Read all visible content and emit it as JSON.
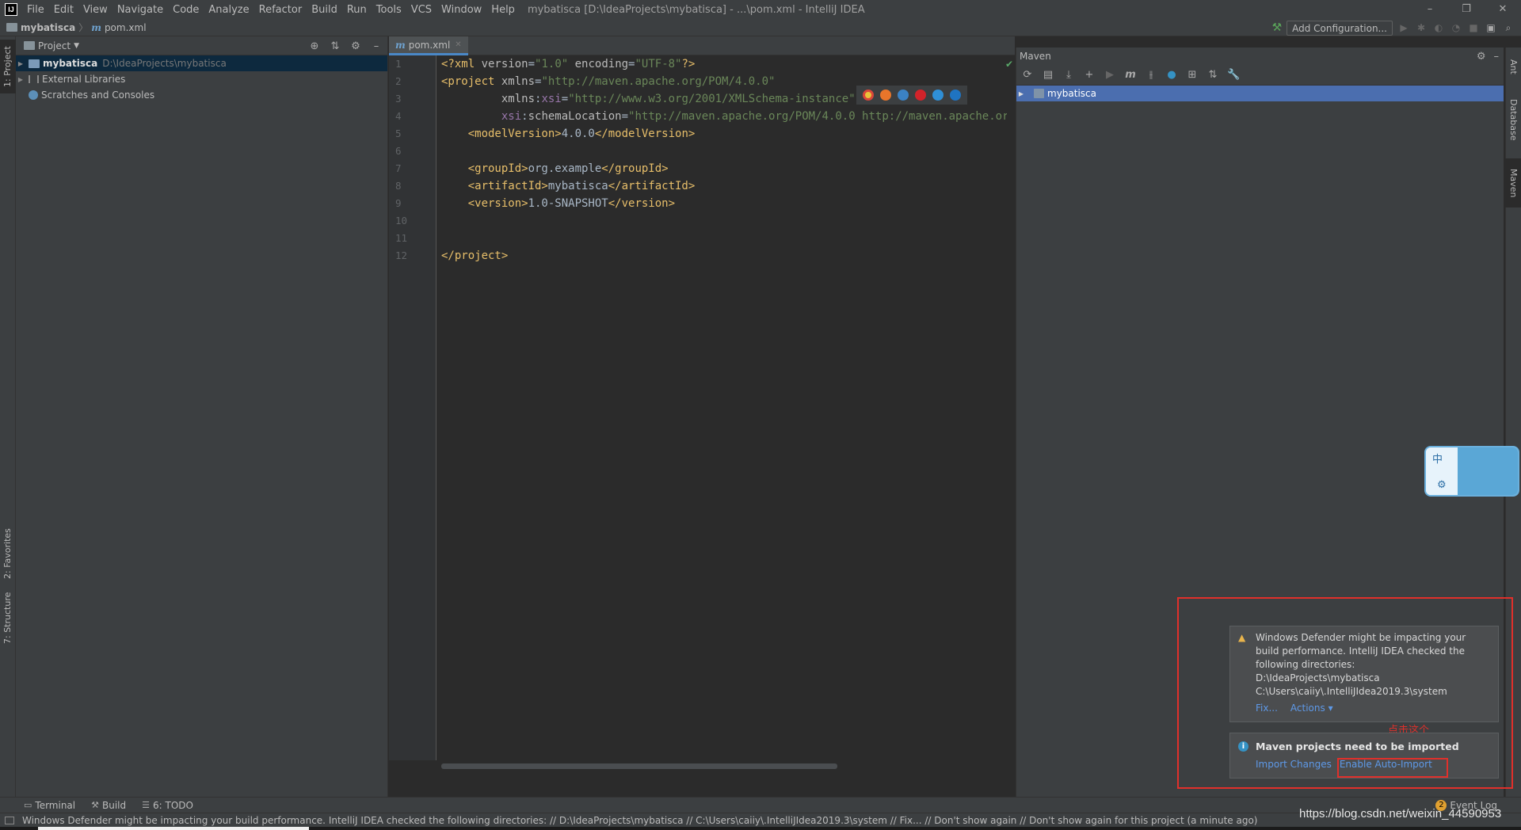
{
  "titlebar": {
    "logo": "IJ",
    "menus": [
      "File",
      "Edit",
      "View",
      "Navigate",
      "Code",
      "Analyze",
      "Refactor",
      "Build",
      "Run",
      "Tools",
      "VCS",
      "Window",
      "Help"
    ],
    "window_title": "mybatisca [D:\\IdeaProjects\\mybatisca] - ...\\pom.xml - IntelliJ IDEA",
    "controls": {
      "minimize": "–",
      "restore": "❐",
      "close": "✕"
    }
  },
  "navbar": {
    "project": "mybatisca",
    "file": "pom.xml",
    "add_configuration": "Add Configuration..."
  },
  "left_stripe": {
    "project_tab": "1: Project",
    "favorites_tab": "2: Favorites",
    "structure_tab": "7: Structure"
  },
  "project_panel": {
    "title": "Project",
    "tree": [
      {
        "label": "mybatisca",
        "path": "D:\\IdeaProjects\\mybatisca"
      },
      {
        "label": "External Libraries"
      },
      {
        "label": "Scratches and Consoles"
      }
    ]
  },
  "editor": {
    "tab_label": "pom.xml",
    "line_numbers": [
      "1",
      "2",
      "3",
      "4",
      "5",
      "6",
      "7",
      "8",
      "9",
      "10",
      "11",
      "12"
    ]
  },
  "maven": {
    "title": "Maven",
    "project": "mybatisca"
  },
  "right_stripe": {
    "ant_tab": "Ant",
    "database_tab": "Database",
    "maven_tab": "Maven"
  },
  "ime": {
    "char": "中"
  },
  "notifications": {
    "defender": {
      "lines": [
        "Windows Defender might be impacting your",
        "build performance. IntelliJ IDEA checked the",
        "following directories:",
        "D:\\IdeaProjects\\mybatisca",
        "C:\\Users\\caiiy\\.IntelliJIdea2019.3\\system"
      ],
      "fix": "Fix...",
      "actions": "Actions ▾"
    },
    "maven_import": {
      "title": "Maven projects need to be imported",
      "import_changes": "Import Changes",
      "enable_auto_import": "Enable Auto-Import"
    },
    "annotation": "点击这个"
  },
  "bottom_bar": {
    "terminal": "Terminal",
    "build": "Build",
    "todo": "6: TODO",
    "event_log": "Event Log",
    "event_count": "2"
  },
  "status_bar": {
    "message": "Windows Defender might be impacting your build performance. IntelliJ IDEA checked the following directories: // D:\\IdeaProjects\\mybatisca // C:\\Users\\caiiy\\.IntelliJIdea2019.3\\system // Fix... // Don't show again // Don't show again for this project (a minute ago)"
  },
  "watermark": "https://blog.csdn.net/weixin_44590953",
  "colors": {
    "accent_blue": "#4b6eaf",
    "annotation_red": "#e0302b",
    "link": "#5e99e8"
  }
}
